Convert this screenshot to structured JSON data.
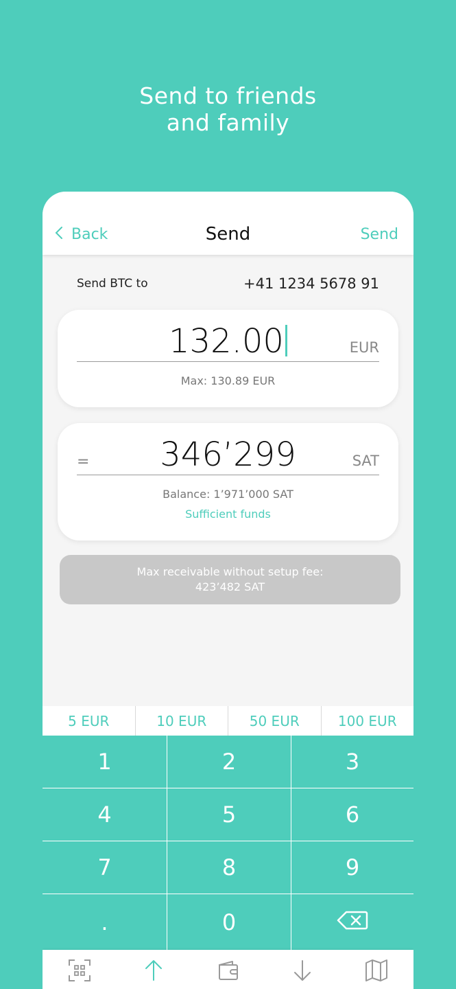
{
  "headline": {
    "line1": "Send to friends",
    "line2": "and family"
  },
  "navbar": {
    "back_label": "Back",
    "title": "Send",
    "action_label": "Send"
  },
  "recipient": {
    "label": "Send BTC to",
    "value": "+41 1234 5678 91"
  },
  "eur_card": {
    "amount": "132.00",
    "unit": "EUR",
    "max_text": "Max: 130.89 EUR"
  },
  "sat_card": {
    "prefix": "=",
    "amount": "346’299",
    "unit": "SAT",
    "balance_text": "Balance: 1’971’000 SAT",
    "status_text": "Sufficient funds"
  },
  "info_box": {
    "line1": "Max receivable without setup fee:",
    "line2": "423’482 SAT"
  },
  "quick_amounts": [
    "5 EUR",
    "10 EUR",
    "50 EUR",
    "100 EUR"
  ],
  "keypad": [
    "1",
    "2",
    "3",
    "4",
    "5",
    "6",
    "7",
    "8",
    "9",
    ".",
    "0"
  ],
  "tabs": [
    {
      "icon": "scan-icon",
      "label": ""
    },
    {
      "icon": "send-arrow-icon",
      "label": ""
    },
    {
      "icon": "wallet-icon",
      "label": ""
    },
    {
      "icon": "receive-arrow-icon",
      "label": ""
    },
    {
      "icon": "map-icon",
      "label": ""
    }
  ],
  "colors": {
    "accent": "#4ecdbb",
    "info_box": "#c8c8c8"
  }
}
